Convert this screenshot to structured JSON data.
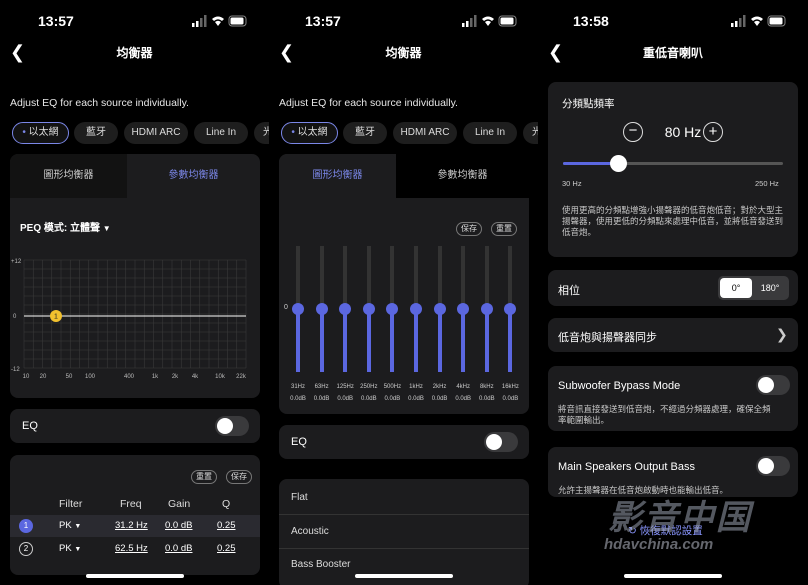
{
  "status": {
    "times": [
      "13:57",
      "13:57",
      "13:58"
    ]
  },
  "screen1": {
    "title": "均衡器",
    "adjust_text": "Adjust EQ for each source individually.",
    "chips": [
      "以太網",
      "藍牙",
      "HDMI ARC",
      "Line In",
      "光"
    ],
    "tabs": {
      "graphic": "圖形均衡器",
      "parametric": "參數均衡器"
    },
    "peq_mode": "PEQ 模式: 立體聲",
    "chart_data": {
      "type": "line",
      "x_ticks": [
        "10",
        "20",
        "50",
        "100",
        "400",
        "1k",
        "2k",
        "4k",
        "10k",
        "22k"
      ],
      "y_top": "+12",
      "y_mid": "0",
      "y_bottom": "-12",
      "ylim": [
        -12,
        12
      ],
      "points": [
        {
          "label": "1",
          "freq": 31.2,
          "gain": 0.0
        }
      ]
    },
    "eq_label": "EQ",
    "reset_label": "重置",
    "save_label": "保存",
    "table": {
      "headers": [
        "Filter",
        "Freq",
        "Gain",
        "Q"
      ],
      "rows": [
        {
          "num": "1",
          "filter": "PK",
          "freq": "31.2 Hz",
          "gain": "0.0 dB",
          "q": "0.25"
        },
        {
          "num": "2",
          "filter": "PK",
          "freq": "62.5 Hz",
          "gain": "0.0 dB",
          "q": "0.25"
        }
      ]
    }
  },
  "screen2": {
    "title": "均衡器",
    "adjust_text": "Adjust EQ for each source individually.",
    "chips": [
      "以太網",
      "藍牙",
      "HDMI ARC",
      "Line In",
      "光"
    ],
    "tabs": {
      "graphic": "圖形均衡器",
      "parametric": "參數均衡器"
    },
    "save_label": "保存",
    "reset_label": "重置",
    "zero_label": "0",
    "bands": [
      {
        "freq": "31Hz",
        "gain": "0.0dB",
        "value": 0
      },
      {
        "freq": "63Hz",
        "gain": "0.0dB",
        "value": 0
      },
      {
        "freq": "125Hz",
        "gain": "0.0dB",
        "value": 0
      },
      {
        "freq": "250Hz",
        "gain": "0.0dB",
        "value": 0
      },
      {
        "freq": "500Hz",
        "gain": "0.0dB",
        "value": 0
      },
      {
        "freq": "1kHz",
        "gain": "0.0dB",
        "value": 0
      },
      {
        "freq": "2kHz",
        "gain": "0.0dB",
        "value": 0
      },
      {
        "freq": "4kHz",
        "gain": "0.0dB",
        "value": 0
      },
      {
        "freq": "8kHz",
        "gain": "0.0dB",
        "value": 0
      },
      {
        "freq": "16kHz",
        "gain": "0.0dB",
        "value": 0
      }
    ],
    "eq_label": "EQ",
    "presets": [
      "Flat",
      "Acoustic",
      "Bass Booster"
    ]
  },
  "screen3": {
    "title": "重低音喇叭",
    "crossover_label": "分頻點頻率",
    "crossover_value": "80 Hz",
    "slider_min": "30 Hz",
    "slider_max": "250 Hz",
    "slider_fraction": 0.25,
    "crossover_desc": "使用更高的分頻點增強小揚聲器的低音炮低音；對於大型主揚聲器，使用更低的分頻點來處理中低音，並將低音發送到低音炮。",
    "phase_label": "相位",
    "phase_options": [
      "0°",
      "180°"
    ],
    "sync_label": "低音炮與揚聲器同步",
    "bypass_label": "Subwoofer Bypass Mode",
    "bypass_desc": "將音訊直接發送到低音炮，不經過分頻器處理，確保全頻率範圍輸出。",
    "output_bass_label": "Main Speakers Output Bass",
    "output_bass_desc": "允許主揚聲器在低音炮啟動時也能輸出低音。",
    "restore_label": "恢復默認設置"
  },
  "watermark": {
    "line1": "影音中国",
    "line2": "hdavchina.com"
  },
  "colors": {
    "accent": "#5b67e0",
    "card": "#1c1c1e",
    "background": "#000000"
  }
}
